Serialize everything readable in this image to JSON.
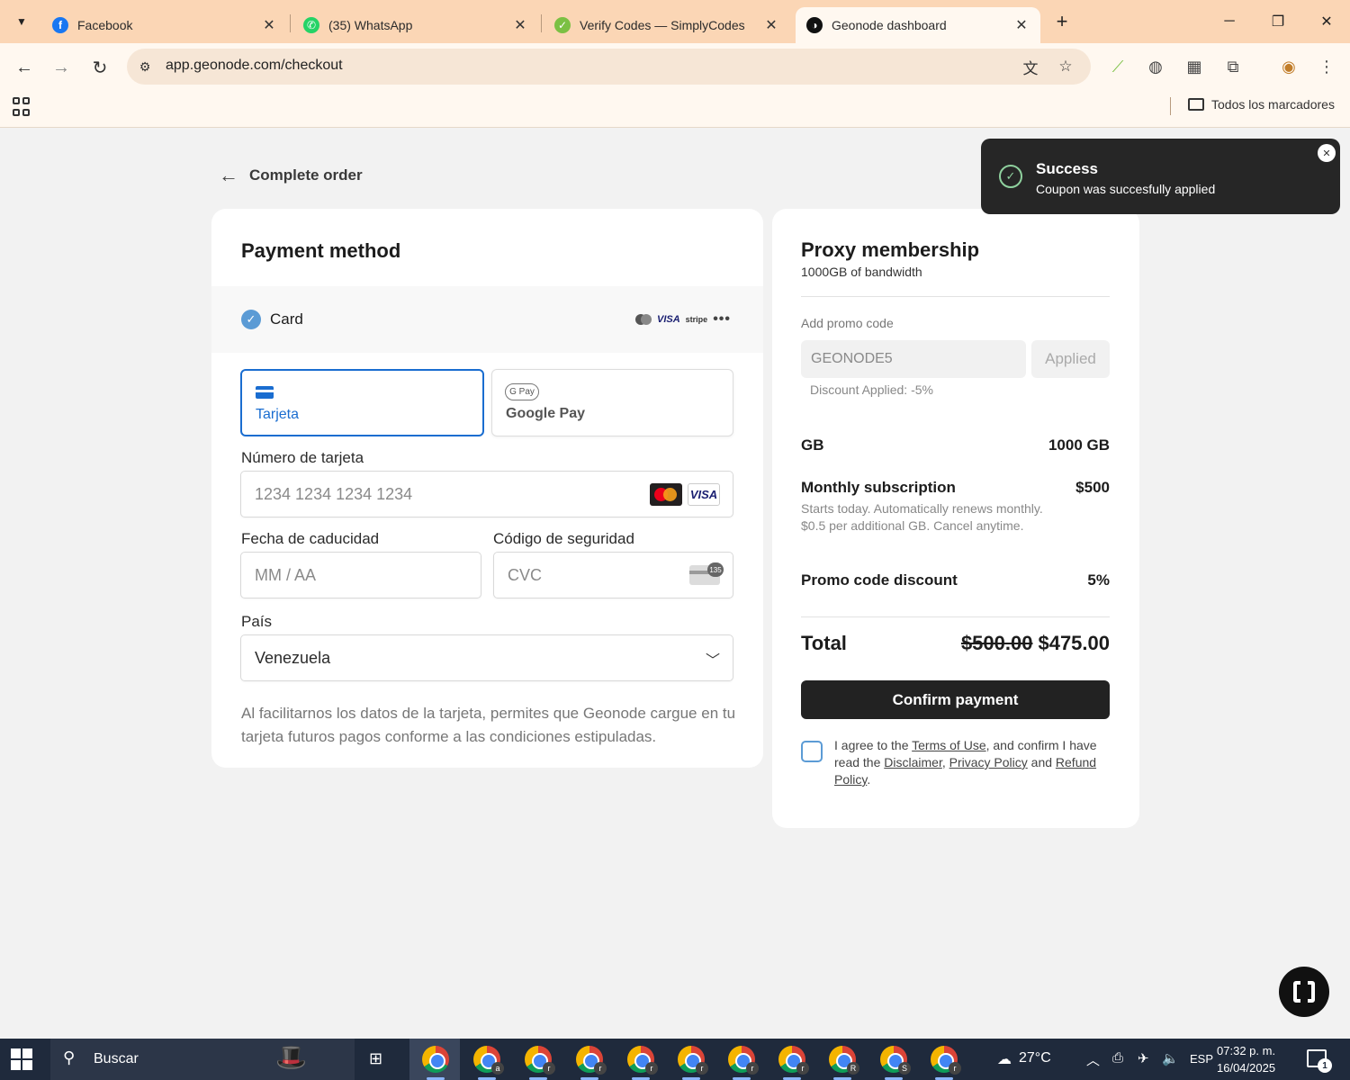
{
  "browser": {
    "tabs": [
      {
        "title": "Facebook",
        "favicon": "facebook-icon",
        "color": "#1877f2",
        "glyph": "f",
        "active": false
      },
      {
        "title": "(35) WhatsApp",
        "favicon": "whatsapp-icon",
        "color": "#25d366",
        "glyph": "✆",
        "active": false
      },
      {
        "title": "Verify Codes — SimplyCodes",
        "favicon": "simplycodes-icon",
        "color": "#7bc043",
        "glyph": "✓",
        "active": false
      },
      {
        "title": "Geonode dashboard",
        "favicon": "geonode-icon",
        "color": "#111111",
        "glyph": "◑",
        "active": true
      }
    ],
    "url": "app.geonode.com/checkout",
    "bookmarks_all": "Todos los marcadores",
    "accent": "#fbd6b5"
  },
  "page": {
    "back_label": "Complete order",
    "payment": {
      "title": "Payment method",
      "card_label": "Card",
      "card_brands": [
        "VISA",
        "stripe"
      ],
      "options": [
        {
          "label": "Tarjeta",
          "selected": true
        },
        {
          "label": "Google Pay",
          "badge": "G Pay",
          "selected": false
        }
      ],
      "card_number": {
        "label": "Número de tarjeta",
        "placeholder": "1234 1234 1234 1234"
      },
      "card_logo_visa": "VISA",
      "expiry": {
        "label": "Fecha de caducidad",
        "placeholder": "MM / AA"
      },
      "cvc": {
        "label": "Código de seguridad",
        "placeholder": "CVC",
        "badge": "135"
      },
      "country": {
        "label": "País",
        "value": "Venezuela"
      },
      "disclaimer": "Al facilitarnos los datos de la tarjeta, permites que Geonode cargue en tu tarjeta futuros pagos conforme a las condiciones estipuladas."
    },
    "summary": {
      "title": "Proxy membership",
      "subtitle": "1000GB of bandwidth",
      "promo_label": "Add promo code",
      "promo_value": "GEONODE5",
      "promo_button": "Applied",
      "discount_note": "Discount Applied: -5%",
      "lines": [
        {
          "label": "GB",
          "value": "1000 GB"
        },
        {
          "label": "Monthly subscription",
          "value": "$500"
        },
        {
          "label": "Promo code discount",
          "value": "5%"
        }
      ],
      "subscription_desc": "Starts today. Automatically renews monthly. $0.5 per additional GB. Cancel anytime.",
      "total_label": "Total",
      "total_old": "$500.00",
      "total_new": "$475.00",
      "confirm_label": "Confirm payment",
      "agree": {
        "t1": "I agree to the ",
        "terms": "Terms of Use",
        "t2": ", and confirm I have read the ",
        "disclaimer": "Disclaimer",
        "t3": ", ",
        "privacy": "Privacy Policy",
        "t4": " and ",
        "refund": "Refund Policy",
        "t5": "."
      }
    },
    "toast": {
      "title": "Success",
      "message": "Coupon was succesfully applied"
    }
  },
  "taskbar": {
    "search_placeholder": "Buscar",
    "app_badges": [
      "a",
      "r",
      "r",
      "r",
      "r",
      "r",
      "r",
      "R",
      "S",
      "r"
    ],
    "temperature": "27°C",
    "language": "ESP",
    "time": "07:32 p. m.",
    "date": "16/04/2025",
    "notifications": "1"
  }
}
